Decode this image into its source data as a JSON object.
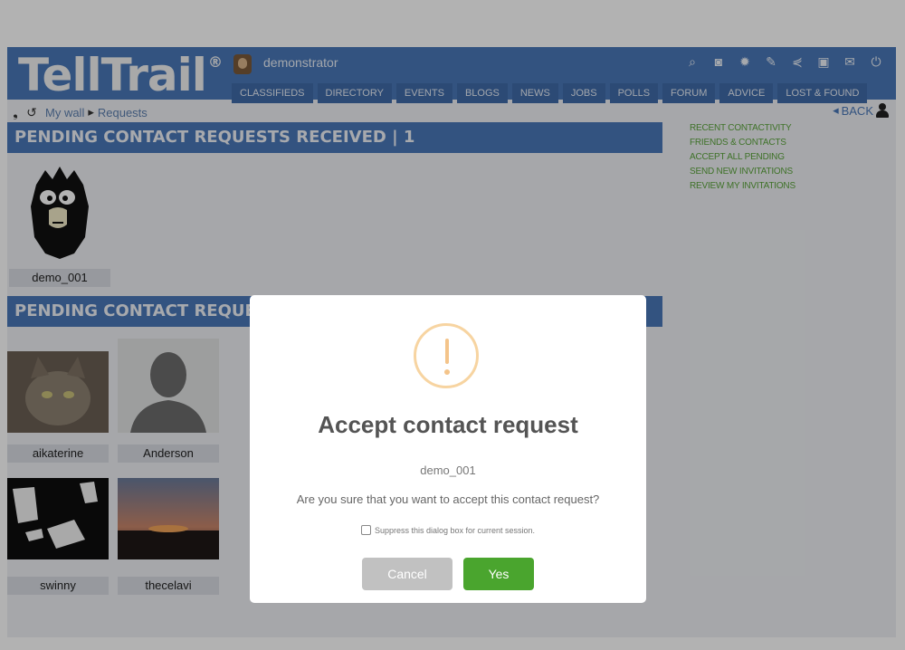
{
  "header": {
    "logo_text": "TellTrail",
    "logo_mark": "®",
    "username": "demonstrator",
    "tool_icons": [
      "search-icon",
      "camera-icon",
      "gear-icon",
      "edit-icon",
      "share-icon",
      "contacts-icon",
      "mail-icon",
      "power-icon"
    ],
    "nav": [
      "CLASSIFIEDS",
      "DIRECTORY",
      "EVENTS",
      "BLOGS",
      "NEWS",
      "JOBS",
      "POLLS",
      "FORUM",
      "ADVICE",
      "LOST & FOUND"
    ]
  },
  "breadcrumb": {
    "wall": "My wall",
    "separator": "▸",
    "current": "Requests"
  },
  "back": {
    "label": "BACK"
  },
  "received": {
    "title": "PENDING CONTACT REQUESTS RECEIVED | 1",
    "items": [
      {
        "name": "demo_001"
      }
    ]
  },
  "sent": {
    "title": "PENDING CONTACT REQUESTS SEN",
    "items": [
      {
        "name": "aikaterine"
      },
      {
        "name": "Anderson"
      },
      {
        "name": "swinny"
      },
      {
        "name": "thecelavi"
      }
    ]
  },
  "sidebar_links": [
    "RECENT CONTACTIVITY",
    "FRIENDS & CONTACTS",
    "ACCEPT ALL PENDING",
    "SEND NEW INVITATIONS",
    "REVIEW MY INVITATIONS"
  ],
  "dialog": {
    "title": "Accept contact request",
    "user": "demo_001",
    "message": "Are you sure that you want to accept this contact request?",
    "suppress": "Suppress this dialog box for current session.",
    "cancel": "Cancel",
    "yes": "Yes"
  },
  "colors": {
    "header": "#4a78b8",
    "accent_green": "#4aa52e",
    "link_green": "#5ba43b",
    "warning": "#f4c48a"
  }
}
